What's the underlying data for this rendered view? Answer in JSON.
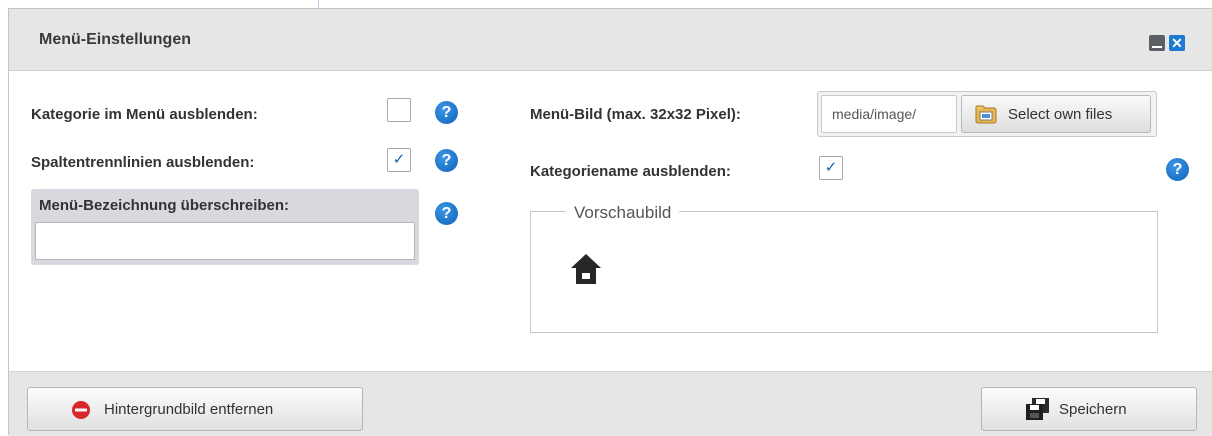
{
  "dialog": {
    "title": "Menü-Einstellungen",
    "minimize_icon": "minimize-icon",
    "close_icon": "close-icon"
  },
  "left_column": {
    "hide_category_label": "Kategorie im Menü ausblenden:",
    "hide_category_checked": false,
    "hide_column_lines_label": "Spaltentrennlinien ausblenden:",
    "hide_column_lines_checked": true,
    "override_label": "Menü-Bezeichnung überschreiben:",
    "override_value": ""
  },
  "right_column": {
    "menu_image_label": "Menü-Bild (max. 32x32 Pixel):",
    "menu_image_value": "media/image/",
    "select_files_label": "Select own files",
    "hide_category_name_label": "Kategoriename ausblenden:",
    "hide_category_name_checked": true,
    "preview_legend": "Vorschaubild",
    "preview_icon": "home-icon"
  },
  "help_icon_glyph": "?",
  "check_glyph": "✓",
  "footer": {
    "remove_background_label": "Hintergrundbild entfernen",
    "save_label": "Speichern"
  },
  "colors": {
    "accent_blue": "#1e7ad1",
    "remove_red": "#d9262b",
    "titlebar_bg": "#e6e6e6"
  }
}
